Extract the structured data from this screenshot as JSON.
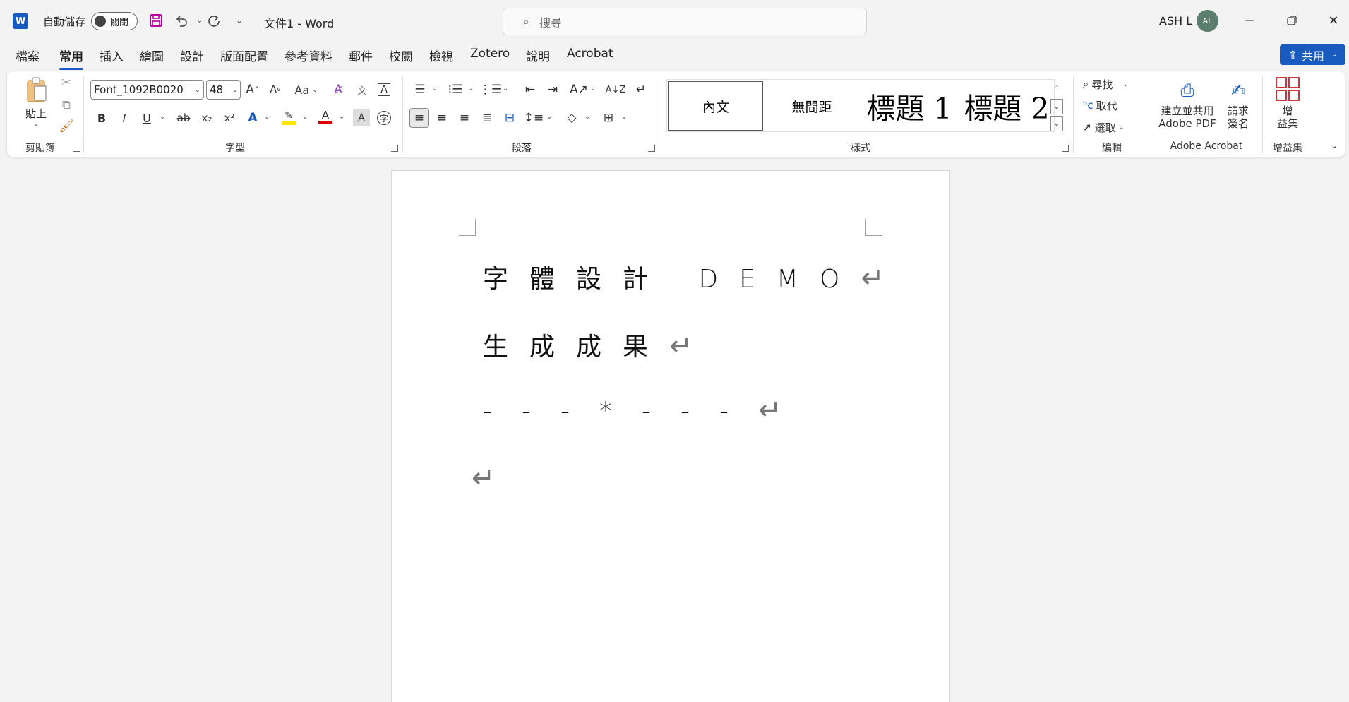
{
  "titlebar": {
    "app_icon_letter": "W",
    "autosave_label": "自動儲存",
    "autosave_state": "關閉",
    "doc_title": "文件1  -  Word",
    "search_placeholder": "搜尋",
    "user_name": "ASH L",
    "avatar_initials": "AL"
  },
  "tabs": [
    "檔案",
    "常用",
    "插入",
    "繪圖",
    "設計",
    "版面配置",
    "參考資料",
    "郵件",
    "校閱",
    "檢視",
    "Zotero",
    "說明",
    "Acrobat"
  ],
  "active_tab": "常用",
  "share_label": "共用",
  "ribbon": {
    "clipboard": {
      "paste_label": "貼上",
      "group_label": "剪貼簿"
    },
    "font": {
      "font_name": "Font_1092B0020",
      "font_size": "48",
      "group_label": "字型",
      "change_case": "Aa",
      "bold": "B",
      "italic": "I",
      "underline": "U",
      "strike": "ab",
      "subscript": "x₂",
      "superscript": "x²"
    },
    "paragraph": {
      "group_label": "段落"
    },
    "styles": {
      "group_label": "樣式",
      "items": [
        "內文",
        "無間距",
        "標題 1",
        "標題 2"
      ]
    },
    "editing": {
      "group_label": "編輯",
      "find": "尋找",
      "replace": "取代",
      "select": "選取"
    },
    "acrobat": {
      "group_label": "Adobe Acrobat",
      "create_line1": "建立並共用",
      "create_line2": "Adobe PDF",
      "sign_line1": "請求",
      "sign_line2": "簽名"
    },
    "addins": {
      "group_label": "增益集",
      "btn_line1": "增",
      "btn_line2": "益集"
    }
  },
  "document": {
    "lines": [
      "字體設計 DEMO",
      "生成成果",
      "---*---",
      ""
    ],
    "paragraph_mark": "↵"
  },
  "colors": {
    "accent": "#185abd",
    "highlight": "#ffe500",
    "font_color": "#e00000"
  },
  "icons": [
    "word-logo-icon",
    "save-icon",
    "undo-icon",
    "redo-icon",
    "search-icon",
    "minimize-icon",
    "restore-icon",
    "close-icon"
  ]
}
